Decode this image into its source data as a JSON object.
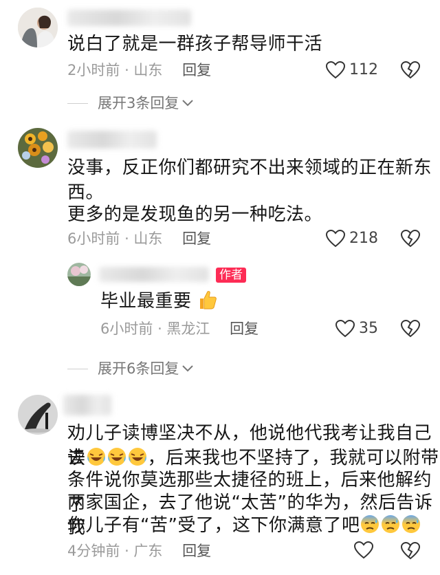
{
  "comments": [
    {
      "text": "说白了就是一群孩子帮导师干活",
      "time": "2小时前",
      "location": "山东",
      "reply_label": "回复",
      "likes": "112",
      "expand_label": "展开3条回复"
    },
    {
      "text_line1": "没事，反正你们都研究不出来领域的正在新东",
      "text_line2": "西。",
      "text_line3": "更多的是发现鱼的另一种吃法。",
      "time": "6小时前",
      "location": "山东",
      "reply_label": "回复",
      "likes": "218",
      "reply": {
        "author_tag": "作者",
        "text": "毕业最重要",
        "emoji": "thumbs-up",
        "time": "6小时前",
        "location": "黑龙江",
        "reply_label": "回复",
        "likes": "35"
      },
      "expand_label": "展开6条回复"
    },
    {
      "text_line1": "劝儿子读博坚决不从，他说他代我考让我自己去",
      "text_line2_prefix": "读",
      "text_line2_suffix": "，后来我也不坚持了，我就可以附带",
      "text_line3": "条件说你莫选那些太捷径的班上，后来他解约了",
      "text_line4": "两家国企，去了他说“太苦”的华为，然后告诉我",
      "text_line5": "你儿子有“苦”受了，这下你满意了吧",
      "emoji_after_du": "rolling-on-floor-laughing x3",
      "emoji_end": "cold-sweat x3",
      "time": "4分钟前",
      "location": "广东",
      "reply_label": "回复"
    }
  ],
  "colors": {
    "author_tag": "#fd2c55",
    "meta": "#9a9a9a"
  }
}
